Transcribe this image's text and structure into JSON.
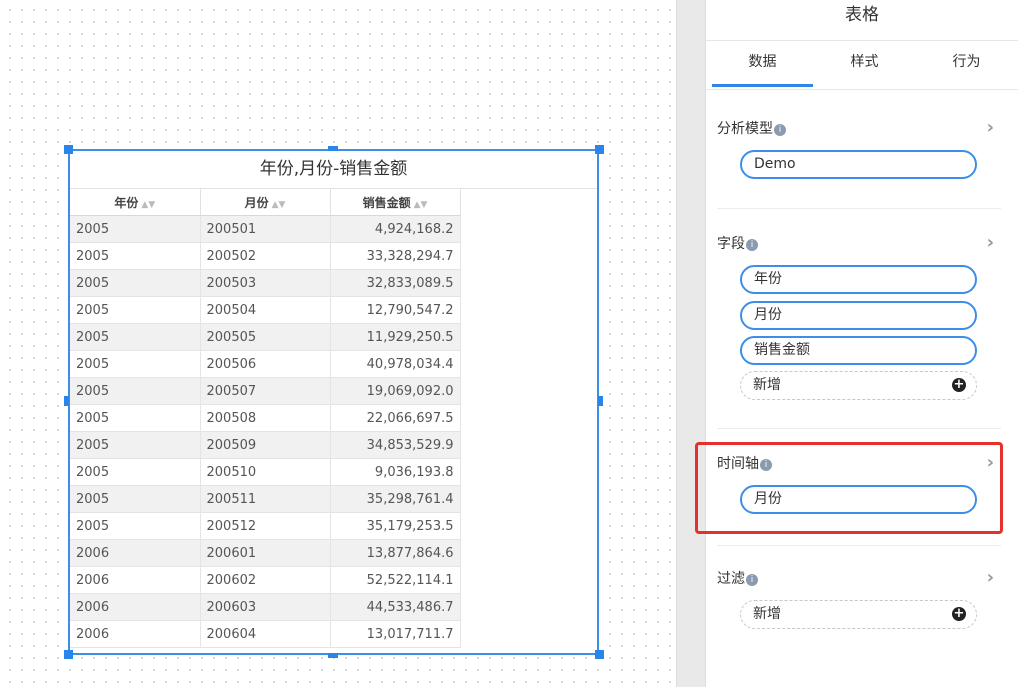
{
  "widget": {
    "title": "年份,月份-销售金额",
    "columns": [
      {
        "label": "年份",
        "sort_icon": "sort-icon"
      },
      {
        "label": "月份",
        "sort_icon": "sort-icon"
      },
      {
        "label": "销售金额",
        "sort_icon": "sort-icon"
      }
    ],
    "rows": [
      [
        "2005",
        "200501",
        "4,924,168.2"
      ],
      [
        "2005",
        "200502",
        "33,328,294.7"
      ],
      [
        "2005",
        "200503",
        "32,833,089.5"
      ],
      [
        "2005",
        "200504",
        "12,790,547.2"
      ],
      [
        "2005",
        "200505",
        "11,929,250.5"
      ],
      [
        "2005",
        "200506",
        "40,978,034.4"
      ],
      [
        "2005",
        "200507",
        "19,069,092.0"
      ],
      [
        "2005",
        "200508",
        "22,066,697.5"
      ],
      [
        "2005",
        "200509",
        "34,853,529.9"
      ],
      [
        "2005",
        "200510",
        "9,036,193.8"
      ],
      [
        "2005",
        "200511",
        "35,298,761.4"
      ],
      [
        "2005",
        "200512",
        "35,179,253.5"
      ],
      [
        "2006",
        "200601",
        "13,877,864.6"
      ],
      [
        "2006",
        "200602",
        "52,522,114.1"
      ],
      [
        "2006",
        "200603",
        "44,533,486.7"
      ],
      [
        "2006",
        "200604",
        "13,017,711.7"
      ]
    ]
  },
  "panel": {
    "title": "表格",
    "tabs": [
      "数据",
      "样式",
      "行为"
    ],
    "active_tab": "数据",
    "model": {
      "label": "分析模型",
      "value": "Demo"
    },
    "fields": {
      "label": "字段",
      "items": [
        "年份",
        "月份",
        "销售金额"
      ],
      "add_label": "新增"
    },
    "timeline": {
      "label": "时间轴",
      "value": "月份"
    },
    "filter": {
      "label": "过滤",
      "add_label": "新增"
    }
  },
  "colors": {
    "accent": "#3b8fe8",
    "highlight": "#e5312d",
    "row_stripe": "#f1f1f1"
  }
}
